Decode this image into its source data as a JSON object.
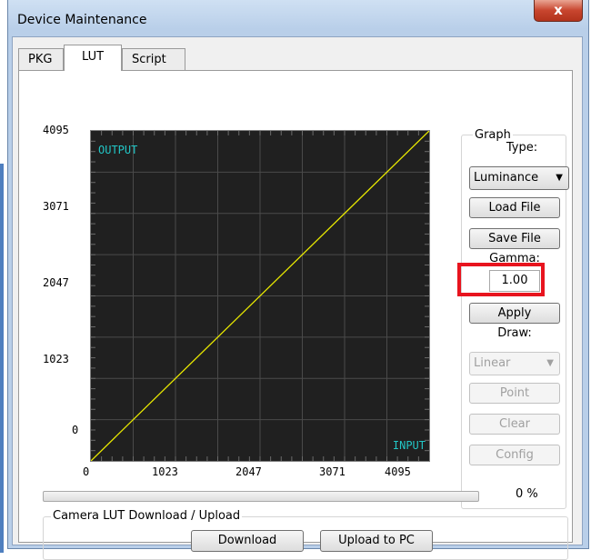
{
  "window": {
    "title": "Device Maintenance",
    "close_symbol": "x"
  },
  "tabs": [
    {
      "label": "PKG",
      "active": false
    },
    {
      "label": "LUT",
      "active": true
    },
    {
      "label": "Script",
      "active": false
    }
  ],
  "graph": {
    "y_tick_labels": [
      "4095",
      "3071",
      "2047",
      "1023",
      "0"
    ],
    "x_tick_labels": [
      "0",
      "1023",
      "2047",
      "3071",
      "4095"
    ],
    "output_label": "OUTPUT",
    "input_label": "INPUT",
    "line_color": "#e8e800",
    "label_color": "#22c6c6"
  },
  "chart_data": {
    "type": "line",
    "x": [
      0,
      4095
    ],
    "series": [
      {
        "values": [
          0,
          4095
        ]
      }
    ],
    "xlim": [
      0,
      4095
    ],
    "ylim": [
      0,
      4095
    ],
    "xlabel": "INPUT",
    "ylabel": "OUTPUT",
    "grid": true
  },
  "controls": {
    "group_label": "Graph",
    "type_label": "Type:",
    "type_value": "Luminance",
    "load_file": "Load File",
    "save_file": "Save File",
    "gamma_label": "Gamma:",
    "gamma_value": "1.00",
    "apply": "Apply",
    "draw_label": "Draw:",
    "draw_value": "Linear",
    "point": "Point",
    "clear": "Clear",
    "config": "Config",
    "highlight_color": "#e8141e"
  },
  "progress": {
    "fraction": 0,
    "text": "0 %"
  },
  "transfer": {
    "group_label": "Camera LUT Download / Upload",
    "download": "Download",
    "upload": "Upload to PC"
  }
}
